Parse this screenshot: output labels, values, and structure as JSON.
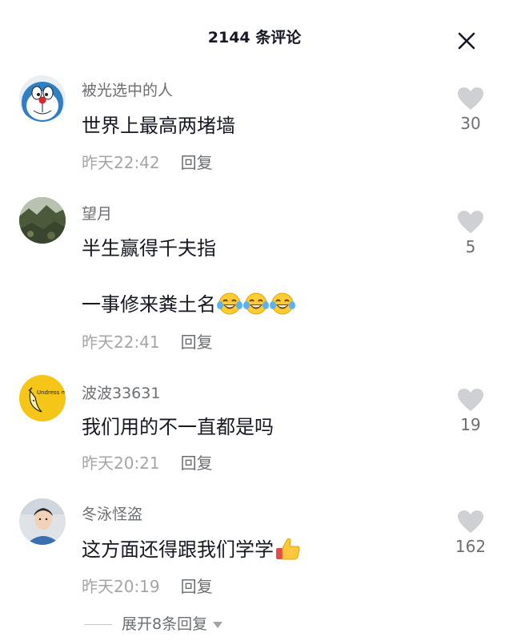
{
  "header": {
    "title": "2144 条评论"
  },
  "comments": [
    {
      "username": "被光选中的人",
      "lines": [
        "世界上最高两堵墙"
      ],
      "time": "昨天22:42",
      "reply_label": "回复",
      "likes": "30",
      "avatar_icon": "doraemon-avatar"
    },
    {
      "username": "望月",
      "lines": [
        "半生赢得千夫指",
        "一事修来粪土名"
      ],
      "emoji": "laughing-tears-emoji x3",
      "time": "昨天22:41",
      "reply_label": "回复",
      "likes": "5",
      "avatar_icon": "landscape-avatar"
    },
    {
      "username": "波波33631",
      "lines": [
        "我们用的不一直都是吗"
      ],
      "time": "昨天20:21",
      "reply_label": "回复",
      "likes": "19",
      "avatar_icon": "banana-avatar",
      "avatar_text": "Undress me"
    },
    {
      "username": "冬泳怪盗",
      "lines": [
        "这方面还得跟我们学学"
      ],
      "emoji": "thumbs-up-emoji",
      "time": "昨天20:19",
      "reply_label": "回复",
      "likes": "162",
      "avatar_icon": "person-avatar"
    }
  ],
  "expand_replies": {
    "label": "展开8条回复"
  },
  "colors": {
    "text_primary": "#161823",
    "text_secondary": "#6b6e75",
    "text_muted": "#a4a5aa",
    "heart": "#cfd0d3",
    "avatar_yellow": "#f5c518"
  }
}
